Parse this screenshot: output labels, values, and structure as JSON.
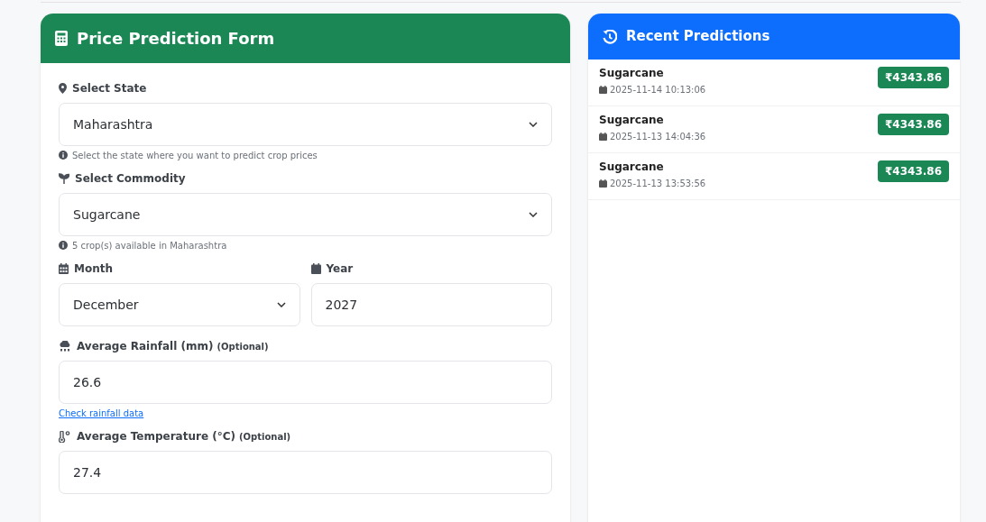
{
  "form": {
    "title": "Price Prediction Form",
    "rows": [
      {
        "fields": [
          {
            "kind": "select",
            "label": "Select State",
            "value": "Maharashtra"
          }
        ],
        "hint": {
          "kind": "info",
          "text": "Select the state where you want to predict crop prices"
        }
      },
      {
        "fields": [
          {
            "kind": "select",
            "label": "Select Commodity",
            "value": "Sugarcane"
          }
        ],
        "hint": {
          "kind": "info",
          "text": "5 crop(s) available in Maharashtra"
        }
      },
      {
        "fields": [
          {
            "kind": "select",
            "label": "Month",
            "value": "December"
          },
          {
            "kind": "input",
            "label": "Year",
            "value": "2027"
          }
        ]
      },
      {
        "fields": [
          {
            "kind": "input",
            "label": "Average Rainfall (mm)",
            "note": "(Optional)",
            "value": "26.6"
          }
        ],
        "hint": {
          "kind": "link",
          "text": "Check rainfall data"
        }
      },
      {
        "fields": [
          {
            "kind": "input",
            "label": "Average Temperature (°C)",
            "note": "(Optional)",
            "value": "27.4"
          }
        ]
      }
    ]
  },
  "recent": {
    "title": "Recent Predictions",
    "items": [
      {
        "crop": "Sugarcane",
        "time": "2025-11-14 10:13:06",
        "price": "₹4343.86"
      },
      {
        "crop": "Sugarcane",
        "time": "2025-11-13 14:04:36",
        "price": "₹4343.86"
      },
      {
        "crop": "Sugarcane",
        "time": "2025-11-13 13:53:56",
        "price": "₹4343.86"
      }
    ]
  }
}
